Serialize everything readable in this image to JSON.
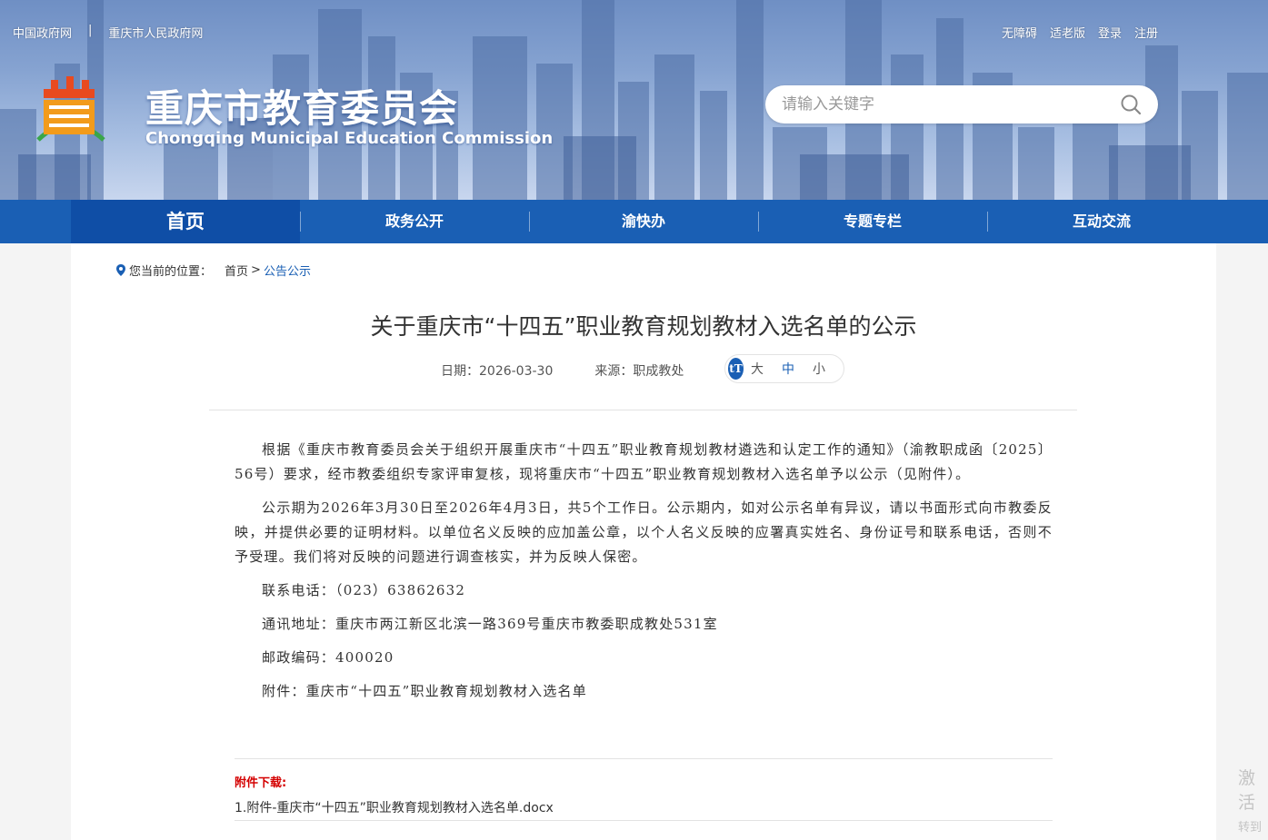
{
  "topbar": {
    "left_links": [
      "中国政府网",
      "重庆市人民政府网"
    ],
    "separator": "|",
    "right_links": [
      "无障碍",
      "适老版",
      "登录",
      "注册"
    ]
  },
  "header": {
    "title": "重庆市教育委员会",
    "subtitle": "Chongqing Municipal Education Commission",
    "search_placeholder": "请输入关键字"
  },
  "nav": {
    "items": [
      "首页",
      "政务公开",
      "渝快办",
      "专题专栏",
      "互动交流"
    ],
    "active_index": 0
  },
  "breadcrumb": {
    "label": "您当前的位置：",
    "home": "首页",
    "sep": ">",
    "current": "公告公示"
  },
  "article": {
    "title": "关于重庆市“十四五”职业教育规划教材入选名单的公示",
    "date": "日期：2026-03-30",
    "source": "来源：职成教处",
    "font_sizes": [
      "大",
      "中",
      "小"
    ],
    "font_size_selected": "中",
    "font_icon": "tT",
    "paragraphs": [
      "根据《重庆市教育委员会关于组织开展重庆市“十四五”职业教育规划教材遴选和认定工作的通知》（渝教职成函〔2025〕56号）要求，经市教委组织专家评审复核，现将重庆市“十四五”职业教育规划教材入选名单予以公示（见附件）。",
      "公示期为2026年3月30日至2026年4月3日，共5个工作日。公示期内，如对公示名单有异议，请以书面形式向市教委反映，并提供必要的证明材料。以单位名义反映的应加盖公章，以个人名义反映的应署真实姓名、身份证号和联系电话，否则不予受理。我们将对反映的问题进行调查核实，并为反映人保密。",
      "联系电话：（023）63862632",
      "通讯地址：重庆市两江新区北滨一路369号重庆市教委职成教处531室",
      "邮政编码：400020",
      "附件：重庆市“十四五”职业教育规划教材入选名单"
    ]
  },
  "attachments": {
    "title": "附件下载:",
    "files": [
      "1.附件-重庆市“十四五”职业教育规划教材入选名单.docx"
    ]
  },
  "watermark": {
    "line1": "激活",
    "line2": "转到"
  },
  "colors": {
    "nav_blue": "#1a5fb4",
    "attach_red": "#d40000"
  }
}
